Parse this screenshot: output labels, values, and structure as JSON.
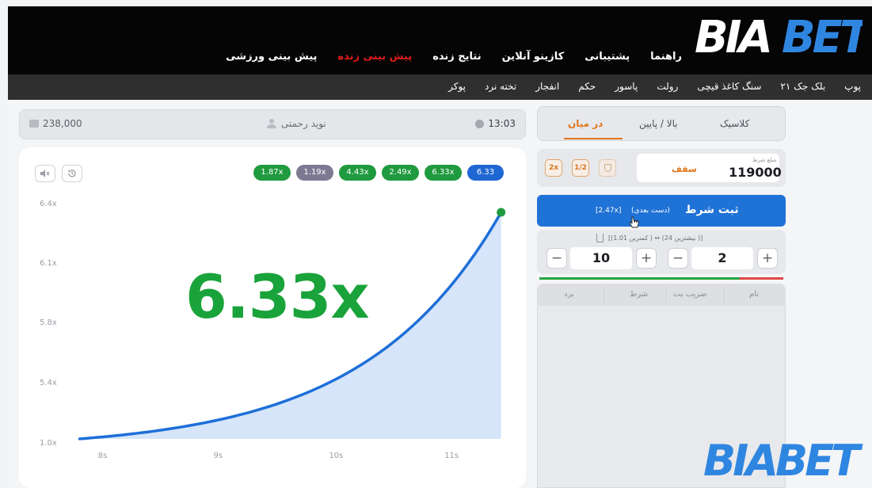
{
  "brand": {
    "logo_text": "BIABET",
    "colors": {
      "logo_white": "#ffffff",
      "logo_blue": "#2f86e0",
      "accent_orange": "#e0761b",
      "accent_green": "#19a33a",
      "bet_blue": "#1f72d6"
    }
  },
  "main_nav": [
    {
      "label": "پیش بینی ورزشی",
      "live": false
    },
    {
      "label": "پیش بینی زنده",
      "live": true
    },
    {
      "label": "نتایج زنده",
      "live": false
    },
    {
      "label": "کازینو آنلاین",
      "live": false
    },
    {
      "label": "پشتیبانی",
      "live": false
    },
    {
      "label": "راهنما",
      "live": false
    }
  ],
  "game_nav": [
    "پوکر",
    "تخته نرد",
    "انفجار",
    "حکم",
    "پاسور",
    "رولت",
    "سنگ کاغذ قیچی",
    "بلک جک ۲۱",
    "پوپ"
  ],
  "info_bar": {
    "balance": "238,000",
    "username": "نوید رحمتی",
    "time": "13:03"
  },
  "history_chips": [
    {
      "value": "1.87x",
      "color": "green"
    },
    {
      "value": "1.19x",
      "color": "purple"
    },
    {
      "value": "4.43x",
      "color": "green"
    },
    {
      "value": "2.49x",
      "color": "green"
    },
    {
      "value": "6.33x",
      "color": "green"
    },
    {
      "value": "6.33",
      "color": "blue"
    }
  ],
  "current_multiplier": "6.33x",
  "chart_data": {
    "type": "area",
    "y_ticks": [
      "6.4x",
      "6.1x",
      "5.8x",
      "5.4x",
      "1.0x"
    ],
    "x_ticks": [
      "8s",
      "9s",
      "10s",
      "11s"
    ],
    "curve": {
      "t_start": 7.8,
      "t_end": 11.45,
      "y_start": 1.0,
      "y_end": 6.33
    },
    "colors": {
      "line": "#1e6fd9",
      "fill": "#cfe0f8",
      "end_dot": "#1f9a3e"
    }
  },
  "bet_panel": {
    "tabs": [
      {
        "label": "کلاسیک",
        "active": false
      },
      {
        "label": "بالا / پایین",
        "active": false
      },
      {
        "label": "در میان",
        "active": true
      }
    ],
    "stake_caption": "مبلغ شرط",
    "stake_value": "119000",
    "stake_currency": "سقف",
    "half_label": "1/2",
    "double_label": "2x",
    "bet_button_label": "ثبت شرط",
    "bet_button_sub": "(دست بعدی)",
    "bet_button_mult": "[2.47x]",
    "range_hint": "[(کمترین 1.01 ) ↔ (بیشترین 24 )]",
    "range_low": "10",
    "range_high": "2",
    "win_fraction": 0.82
  },
  "history_table": {
    "columns": [
      "نام",
      "ضریب بت",
      "شرط",
      "برد"
    ]
  },
  "watermark_logo": "BIABET"
}
